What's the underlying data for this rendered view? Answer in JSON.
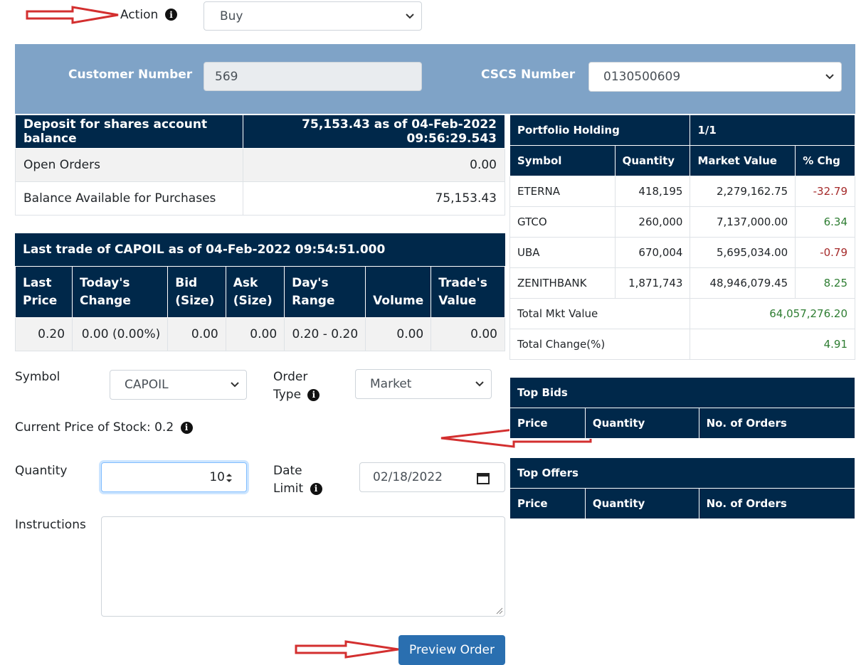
{
  "action": {
    "label": "Action",
    "value": "Buy"
  },
  "customer": {
    "label": "Customer Number",
    "value": "569",
    "cscs_label": "CSCS Number",
    "cscs_value": "0130500609"
  },
  "balance": {
    "header_label": "Deposit for shares account balance",
    "header_value": "75,153.43 as of 04-Feb-2022 09:56:29.543",
    "rows": [
      {
        "label": "Open Orders",
        "value": "0.00"
      },
      {
        "label": "Balance Available for Purchases",
        "value": "75,153.43"
      }
    ]
  },
  "last_trade": {
    "title": "Last trade of CAPOIL as of 04-Feb-2022 09:54:51.000",
    "columns": [
      "Last Price",
      "Today's Change",
      "Bid (Size)",
      "Ask (Size)",
      "Day's Range",
      "Volume",
      "Trade's Value"
    ],
    "values": [
      "0.20",
      "0.00 (0.00%)",
      "0.00",
      "0.00",
      "0.20 - 0.20",
      "0.00",
      "0.00"
    ]
  },
  "portfolio": {
    "title": "Portfolio Holding",
    "page": "1/1",
    "columns": [
      "Symbol",
      "Quantity",
      "Market Value",
      "% Chg"
    ],
    "rows": [
      {
        "symbol": "ETERNA",
        "quantity": "418,195",
        "market_value": "2,279,162.75",
        "chg": "-32.79"
      },
      {
        "symbol": "GTCO",
        "quantity": "260,000",
        "market_value": "7,137,000.00",
        "chg": "6.34"
      },
      {
        "symbol": "UBA",
        "quantity": "670,004",
        "market_value": "5,695,034.00",
        "chg": "-0.79"
      },
      {
        "symbol": "ZENITHBANK",
        "quantity": "1,871,743",
        "market_value": "48,946,079.45",
        "chg": "8.25"
      }
    ],
    "total_mkt_label": "Total Mkt Value",
    "total_mkt_value": "64,057,276.20",
    "total_change_label": "Total Change(%)",
    "total_change_value": "4.91"
  },
  "order": {
    "symbol_label": "Symbol",
    "symbol_value": "CAPOIL",
    "order_type_label_1": "Order",
    "order_type_label_2": "Type",
    "order_type_value": "Market",
    "current_price": "Current Price of Stock: 0.2",
    "quantity_label": "Quantity",
    "quantity_value": "10",
    "date_label_1": "Date",
    "date_label_2": "Limit",
    "date_value": "02/18/2022",
    "instructions_label": "Instructions",
    "instructions_value": "",
    "preview_button": "Preview Order"
  },
  "top_bids": {
    "title": "Top Bids",
    "columns": [
      "Price",
      "Quantity",
      "No. of Orders"
    ]
  },
  "top_offers": {
    "title": "Top Offers",
    "columns": [
      "Price",
      "Quantity",
      "No. of Orders"
    ]
  },
  "colors": {
    "header_navy": "#00284a",
    "panel_blue": "#7fa3c7",
    "button_blue": "#2a6fb0",
    "arrow_red": "#d32f2f",
    "negative": "#a52a2a",
    "positive": "#2e7d32"
  }
}
